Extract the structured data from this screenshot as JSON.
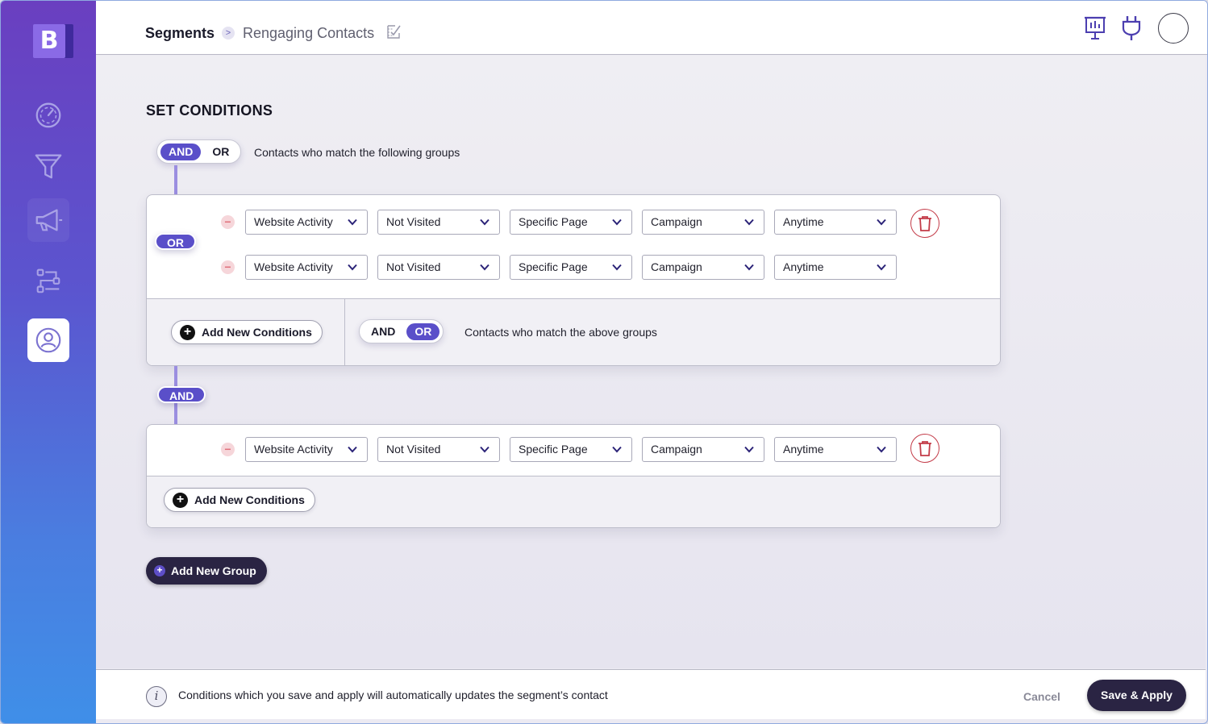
{
  "app": {
    "logo_letter": "B"
  },
  "sidebar": {
    "items": [
      {
        "icon": "gauge-icon"
      },
      {
        "icon": "funnel-icon"
      },
      {
        "icon": "megaphone-icon"
      },
      {
        "icon": "workflow-icon"
      },
      {
        "icon": "contact-icon"
      }
    ]
  },
  "header": {
    "breadcrumb_root": "Segments",
    "breadcrumb_sep": ">",
    "breadcrumb_current": "Rengaging Contacts"
  },
  "main": {
    "title": "SET CONDITIONS",
    "top_toggle": {
      "and": "AND",
      "or": "OR",
      "selected": "AND"
    },
    "top_desc": "Contacts who match the following groups",
    "group1": {
      "inner_pill": "OR",
      "rows": [
        {
          "type": "Website Activity",
          "status": "Not Visited",
          "page": "Specific Page",
          "source": "Campaign",
          "time": "Anytime"
        },
        {
          "type": "Website Activity",
          "status": "Not Visited",
          "page": "Specific Page",
          "source": "Campaign",
          "time": "Anytime"
        }
      ],
      "add_label": "Add New Conditions",
      "footer_toggle": {
        "and": "AND",
        "or": "OR",
        "selected": "OR"
      },
      "footer_desc": "Contacts who match the above groups"
    },
    "connector_pill": "AND",
    "group2": {
      "rows": [
        {
          "type": "Website Activity",
          "status": "Not Visited",
          "page": "Specific Page",
          "source": "Campaign",
          "time": "Anytime"
        }
      ],
      "add_label": "Add New Conditions"
    },
    "add_group_label": "Add New Group"
  },
  "footer": {
    "info_text": "Conditions which you save and apply will automatically updates the segment’s contact",
    "cancel_label": "Cancel",
    "save_label": "Save & Apply"
  },
  "colors": {
    "accent": "#5a4fc9",
    "dark_button": "#2a2443",
    "danger": "#c33b48"
  }
}
